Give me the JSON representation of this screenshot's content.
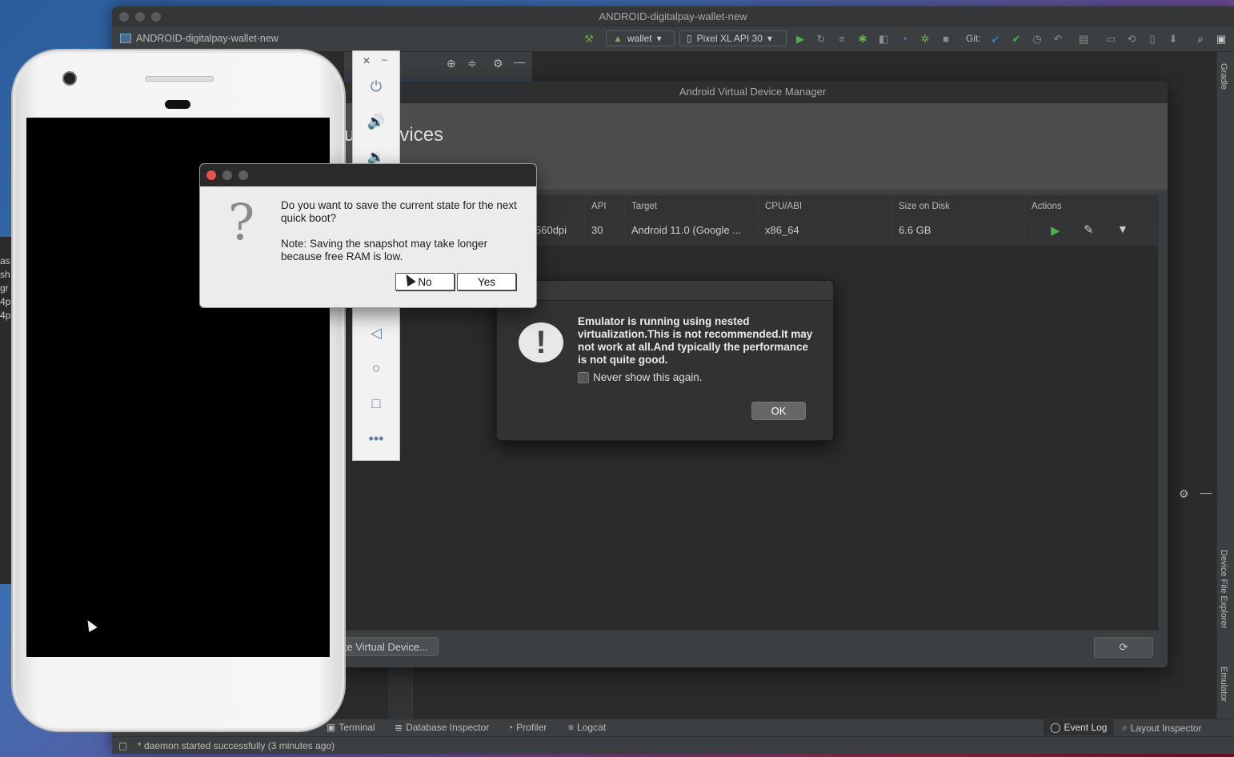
{
  "ide": {
    "window_title": "ANDROID-digitalpay-wallet-new",
    "project_name": "ANDROID-digitalpay-wallet-new",
    "run_config": "wallet",
    "device": "Pixel XL API 30",
    "git_label": "Git:",
    "right_tabs": [
      "Gradle",
      "Device File Explorer",
      "Emulator"
    ],
    "bottom_tabs": [
      "Terminal",
      "Database Inspector",
      "Profiler",
      "Logcat",
      "Event Log",
      "Layout Inspector"
    ],
    "status_text": "* daemon started successfully (3 minutes ago)",
    "left_fragments": [
      "as",
      "sh",
      "gr",
      "4p",
      "4p"
    ]
  },
  "avd": {
    "title": "Android Virtual Device Manager",
    "heading": "ual Devices",
    "columns": [
      "API",
      "Target",
      "CPU/ABI",
      "Size on Disk",
      "Actions"
    ],
    "row": {
      "density": "560dpi",
      "api": "30",
      "target": "Android 11.0 (Google ...",
      "cpu": "x86_64",
      "size": "6.6 GB"
    },
    "create_button": "Create Virtual Device..."
  },
  "warning": {
    "message": "Emulator is running using nested virtualization.This is not recommended.It may not work at all.And typically the performance is not quite good.",
    "checkbox_label": "Never show this again.",
    "ok_label": "OK"
  },
  "save_dialog": {
    "question": "Do you want to save the current state for the next quick boot?",
    "note": "Note: Saving the snapshot may take longer because free RAM is low.",
    "no_label": "No",
    "yes_label": "Yes"
  },
  "colors": {
    "accent_green": "#4caf50",
    "ide_bg": "#2b2b2b",
    "panel_bg": "#3c3f41"
  },
  "icons": [
    "power-icon",
    "volume-up-icon",
    "volume-down-icon",
    "back-icon",
    "home-icon",
    "overview-icon",
    "more-icon",
    "hammer-icon",
    "play-icon",
    "debug-icon",
    "search-icon",
    "gear-icon",
    "refresh-icon",
    "edit-icon"
  ]
}
